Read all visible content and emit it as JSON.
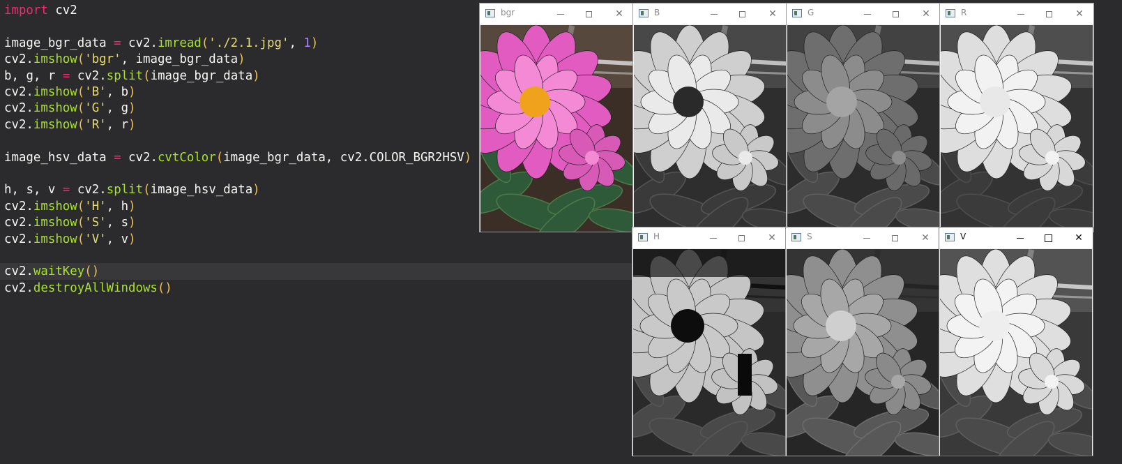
{
  "editor": {
    "lines": [
      "import cv2",
      "",
      "image_bgr_data = cv2.imread('./2.1.jpg', 1)",
      "cv2.imshow('bgr', image_bgr_data)",
      "b, g, r = cv2.split(image_bgr_data)",
      "cv2.imshow('B', b)",
      "cv2.imshow('G', g)",
      "cv2.imshow('R', r)",
      "",
      "image_hsv_data = cv2.cvtColor(image_bgr_data, cv2.COLOR_BGR2HSV)",
      "",
      "h, s, v = cv2.split(image_hsv_data)",
      "cv2.imshow('H', h)",
      "cv2.imshow('S', s)",
      "cv2.imshow('V', v)",
      "",
      "cv2.waitKey()",
      "cv2.destroyAllWindows()"
    ],
    "current_line": 16,
    "colors": {
      "background": "#2b2a2d",
      "keyword": "#f92672",
      "function": "#a6e22e",
      "string": "#e6db74",
      "constant": "#ae81ff",
      "paren": "#f2c14e",
      "text": "#f8f8f2"
    }
  },
  "windows": [
    {
      "title": "bgr",
      "channel": "bgr",
      "active": false,
      "icon": "opencv-window-icon"
    },
    {
      "title": "B",
      "channel": "B",
      "active": false,
      "icon": "opencv-window-icon"
    },
    {
      "title": "G",
      "channel": "G",
      "active": false,
      "icon": "opencv-window-icon"
    },
    {
      "title": "R",
      "channel": "R",
      "active": false,
      "icon": "opencv-window-icon"
    },
    {
      "title": "H",
      "channel": "H",
      "active": false,
      "icon": "opencv-window-icon"
    },
    {
      "title": "S",
      "channel": "S",
      "active": false,
      "icon": "opencv-window-icon"
    },
    {
      "title": "V",
      "channel": "V",
      "active": true,
      "icon": "opencv-window-icon"
    }
  ]
}
